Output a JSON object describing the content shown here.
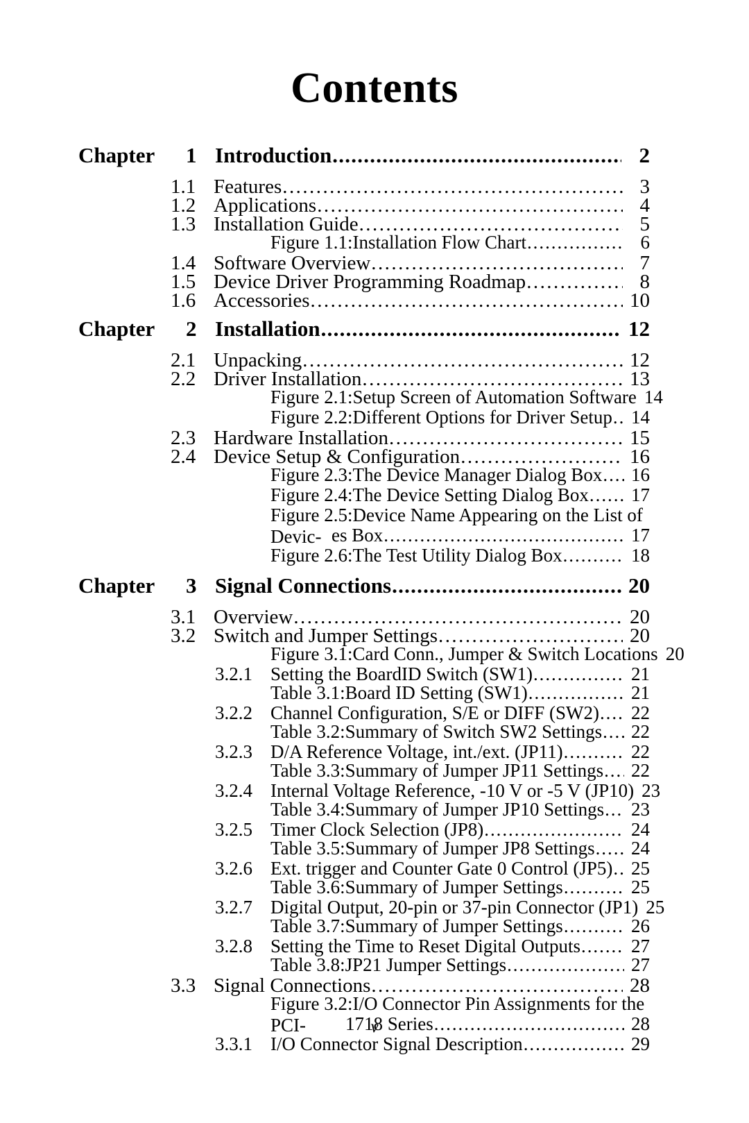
{
  "document": {
    "title": "Contents",
    "folio": "v"
  },
  "chapter_word": "Chapter",
  "chapters": [
    {
      "number": "1",
      "title": "Introduction",
      "page": "2",
      "entries": [
        {
          "kind": "section",
          "number": "1.1",
          "title": "Features",
          "page": "3"
        },
        {
          "kind": "section",
          "number": "1.2",
          "title": "Applications",
          "page": "4"
        },
        {
          "kind": "section",
          "number": "1.3",
          "title": "Installation Guide",
          "page": "5"
        },
        {
          "kind": "figure",
          "title": "Figure 1.1:Installation Flow Chart",
          "page": "6"
        },
        {
          "kind": "section",
          "number": "1.4",
          "title": "Software Overview",
          "page": "7"
        },
        {
          "kind": "section",
          "number": "1.5",
          "title": "Device Driver Programming Roadmap",
          "page": "8"
        },
        {
          "kind": "section",
          "number": "1.6",
          "title": "Accessories",
          "page": "10"
        }
      ]
    },
    {
      "number": "2",
      "title": "Installation",
      "page": "12",
      "entries": [
        {
          "kind": "section",
          "number": "2.1",
          "title": "Unpacking",
          "page": "12"
        },
        {
          "kind": "section",
          "number": "2.2",
          "title": "Driver Installation",
          "page": "13"
        },
        {
          "kind": "figure",
          "title": "Figure 2.1:Setup Screen of Automation Software",
          "page": "14"
        },
        {
          "kind": "figure",
          "title": "Figure 2.2:Different Options for Driver Setup",
          "page": "14"
        },
        {
          "kind": "section",
          "number": "2.3",
          "title": "Hardware Installation",
          "page": "15"
        },
        {
          "kind": "section",
          "number": "2.4",
          "title": "Device Setup & Configuration",
          "page": "16"
        },
        {
          "kind": "figure",
          "title": "Figure 2.3:The Device Manager Dialog Box",
          "page": "16"
        },
        {
          "kind": "figure",
          "title": "Figure 2.4:The Device Setting Dialog Box",
          "page": "17"
        },
        {
          "kind": "figure_wrapped",
          "title_line1": "Figure 2.5:Device Name Appearing on the List of Devic-",
          "title_line2": "es Box",
          "page": "17"
        },
        {
          "kind": "figure",
          "title": "Figure 2.6:The Test Utility Dialog Box",
          "page": "18"
        }
      ]
    },
    {
      "number": "3",
      "title": "Signal Connections",
      "page": "20",
      "entries": [
        {
          "kind": "section",
          "number": "3.1",
          "title": "Overview",
          "page": "20"
        },
        {
          "kind": "section",
          "number": "3.2",
          "title": "Switch and Jumper Settings",
          "page": "20"
        },
        {
          "kind": "figure",
          "title": "Figure 3.1:Card Conn., Jumper & Switch Locations",
          "page": "20"
        },
        {
          "kind": "subsection",
          "number": "3.2.1",
          "title": "Setting the BoardID Switch (SW1)",
          "page": "21"
        },
        {
          "kind": "figure",
          "title": "Table 3.1:Board ID Setting (SW1)",
          "page": "21"
        },
        {
          "kind": "subsection",
          "number": "3.2.2",
          "title": "Channel Configuration, S/E or DIFF (SW2)",
          "page": "22"
        },
        {
          "kind": "figure",
          "title": "Table 3.2:Summary of Switch SW2 Settings",
          "page": "22"
        },
        {
          "kind": "subsection",
          "number": "3.2.3",
          "title": "D/A Reference Voltage, int./ext. (JP11)",
          "page": "22"
        },
        {
          "kind": "figure",
          "title": "Table 3.3:Summary of Jumper JP11 Settings",
          "page": "22"
        },
        {
          "kind": "subsection",
          "number": "3.2.4",
          "title": "Internal Voltage Reference, -10 V or -5 V (JP10)",
          "page": "23"
        },
        {
          "kind": "figure",
          "title": "Table 3.4:Summary of Jumper JP10 Settings",
          "page": "23"
        },
        {
          "kind": "subsection",
          "number": "3.2.5",
          "title": "Timer Clock Selection (JP8)",
          "page": "24"
        },
        {
          "kind": "figure",
          "title": "Table 3.5:Summary of Jumper JP8 Settings",
          "page": "24"
        },
        {
          "kind": "subsection",
          "number": "3.2.6",
          "title": "Ext. trigger and Counter Gate 0 Control (JP5)",
          "page": "25"
        },
        {
          "kind": "figure",
          "title": "Table 3.6:Summary of Jumper Settings",
          "page": "25"
        },
        {
          "kind": "subsection",
          "number": "3.2.7",
          "title": "Digital Output, 20-pin or 37-pin Connector (JP1)",
          "page": "25"
        },
        {
          "kind": "figure",
          "title": "Table 3.7:Summary of Jumper Settings",
          "page": "26"
        },
        {
          "kind": "subsection",
          "number": "3.2.8",
          "title": "Setting the Time to Reset Digital Outputs",
          "page": "27"
        },
        {
          "kind": "figure",
          "title": "Table 3.8:JP21 Jumper Settings",
          "page": "27"
        },
        {
          "kind": "section",
          "number": "3.3",
          "title": "Signal Connections",
          "page": "28"
        },
        {
          "kind": "figure_wrapped_deep",
          "title_line1": "Figure 3.2:I/O Connector Pin Assignments for the PCI-",
          "title_line2": "1718 Series",
          "page": "28"
        },
        {
          "kind": "subsection",
          "number": "3.3.1",
          "title": "I/O Connector Signal Description",
          "page": "29"
        }
      ]
    }
  ]
}
